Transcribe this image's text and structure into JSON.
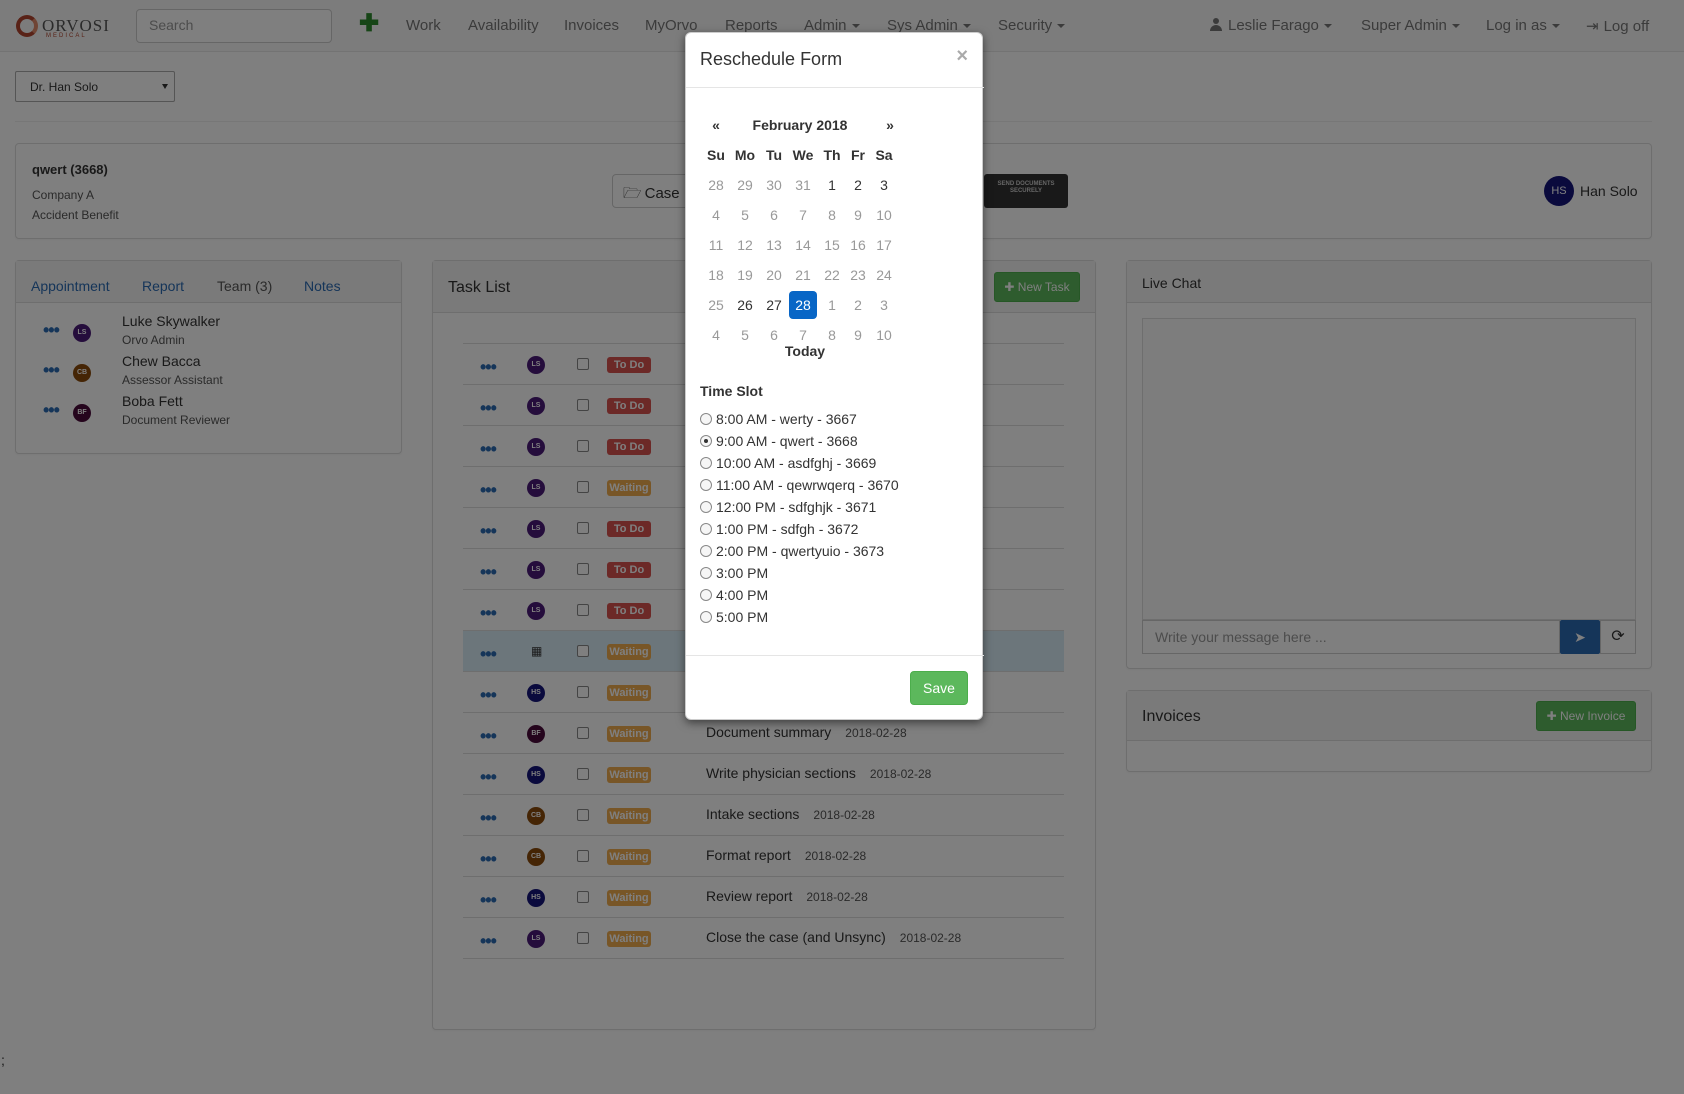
{
  "navbar": {
    "logo_text": "ORVOSI",
    "logo_sub": "MEDICAL",
    "search_placeholder": "Search",
    "items": [
      "Work",
      "Availability",
      "Invoices",
      "MyOrvo",
      "Reports",
      "Admin",
      "Sys Admin",
      "Security"
    ],
    "user": "Leslie Farago",
    "role": "Super Admin",
    "login_as": "Log in as",
    "logoff": "Log off"
  },
  "doctor_select": "Dr. Han Solo",
  "case": {
    "title": "qwert (3668)",
    "company": "Company A",
    "type": "Accident Benefit",
    "case_button": "Case",
    "send_docs": "SEND DOCUMENTS SECURELY",
    "owner_initials": "HS",
    "owner_name": "Han Solo"
  },
  "left_panel": {
    "tabs": [
      "Appointment",
      "Report",
      "Team (3)",
      "Notes"
    ],
    "team": [
      {
        "initials": "LS",
        "name": "Luke Skywalker",
        "role": "Orvo Admin",
        "color": "#4b1a78"
      },
      {
        "initials": "CB",
        "name": "Chew Bacca",
        "role": "Assessor Assistant",
        "color": "#8a4a0a"
      },
      {
        "initials": "BF",
        "name": "Boba Fett",
        "role": "Document Reviewer",
        "color": "#4a0a3a"
      }
    ]
  },
  "task_list": {
    "title": "Task List",
    "new_task": "New Task",
    "tasks": [
      {
        "initials": "LS",
        "status": "To Do",
        "name": "",
        "date": ""
      },
      {
        "initials": "LS",
        "status": "To Do",
        "name": "",
        "date": ""
      },
      {
        "initials": "LS",
        "status": "To Do",
        "name": "",
        "date": ""
      },
      {
        "initials": "LS",
        "status": "Waiting",
        "name": "",
        "date": ""
      },
      {
        "initials": "LS",
        "status": "To Do",
        "name": "",
        "date": ""
      },
      {
        "initials": "LS",
        "status": "To Do",
        "name": "",
        "date": ""
      },
      {
        "initials": "LS",
        "status": "To Do",
        "name": "",
        "date": ""
      },
      {
        "initials": "cal",
        "status": "Waiting",
        "name": "",
        "date": ""
      },
      {
        "initials": "HS",
        "status": "Waiting",
        "name": "",
        "date": ""
      },
      {
        "initials": "BF",
        "status": "Waiting",
        "name": "Document summary",
        "date": "2018-02-28"
      },
      {
        "initials": "HS",
        "status": "Waiting",
        "name": "Write physician sections",
        "date": "2018-02-28"
      },
      {
        "initials": "CB",
        "status": "Waiting",
        "name": "Intake sections",
        "date": "2018-02-28"
      },
      {
        "initials": "CB",
        "status": "Waiting",
        "name": "Format report",
        "date": "2018-02-28"
      },
      {
        "initials": "HS",
        "status": "Waiting",
        "name": "Review report",
        "date": "2018-02-28"
      },
      {
        "initials": "LS",
        "status": "Waiting",
        "name": "Close the case (and Unsync)",
        "date": "2018-02-28"
      }
    ]
  },
  "live_chat": {
    "title": "Live Chat",
    "placeholder": "Write your message here ..."
  },
  "invoices": {
    "title": "Invoices",
    "new_invoice": "New Invoice"
  },
  "modal": {
    "title": "Reschedule Form",
    "close": "×",
    "month": "February 2018",
    "prev": "«",
    "next": "»",
    "weekdays": [
      "Su",
      "Mo",
      "Tu",
      "We",
      "Th",
      "Fr",
      "Sa"
    ],
    "weeks": [
      [
        "28",
        "29",
        "30",
        "31",
        "1",
        "2",
        "3"
      ],
      [
        "4",
        "5",
        "6",
        "7",
        "8",
        "9",
        "10"
      ],
      [
        "11",
        "12",
        "13",
        "14",
        "15",
        "16",
        "17"
      ],
      [
        "18",
        "19",
        "20",
        "21",
        "22",
        "23",
        "24"
      ],
      [
        "25",
        "26",
        "27",
        "28",
        "1",
        "2",
        "3"
      ],
      [
        "4",
        "5",
        "6",
        "7",
        "8",
        "9",
        "10"
      ]
    ],
    "selected_day": "28",
    "today": "Today",
    "time_slot_label": "Time Slot",
    "slots": [
      "8:00 AM - werty - 3667",
      "9:00 AM - qwert - 3668",
      "10:00 AM - asdfghj - 3669",
      "11:00 AM - qewrwqerq - 3670",
      "12:00 PM - sdfghjk - 3671",
      "1:00 PM - sdfgh - 3672",
      "2:00 PM - qwertyuio - 3673",
      "3:00 PM",
      "4:00 PM",
      "5:00 PM"
    ],
    "selected_slot": 1,
    "save": "Save"
  },
  "footer_mark": ";"
}
